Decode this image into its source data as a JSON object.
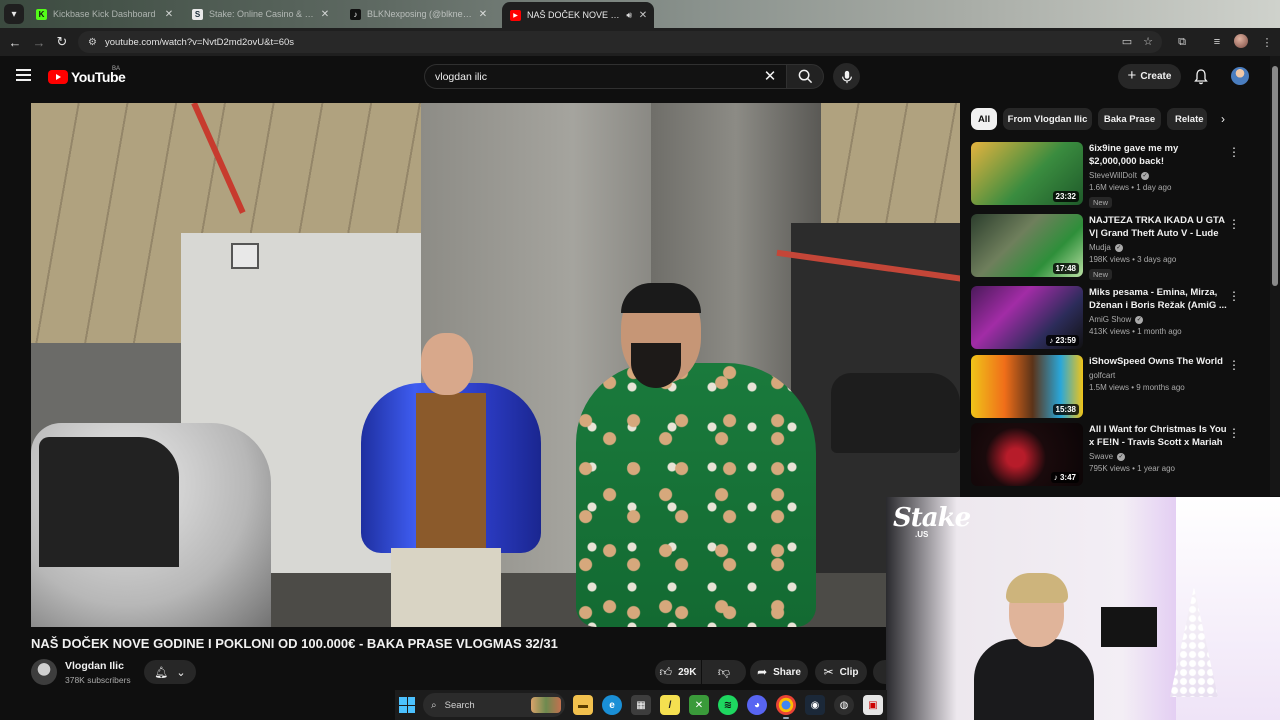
{
  "browser": {
    "tabs": [
      {
        "title": "Kickbase Kick Dashboard",
        "favicon": "kick-favicon"
      },
      {
        "title": "Stake: Online Casino & Sports",
        "favicon": "stake-favicon"
      },
      {
        "title": "BLKNexposing (@blknexposing)",
        "favicon": "tiktok-favicon"
      },
      {
        "title": "NAŠ DOČEK NOVE GODINE I",
        "favicon": "youtube-favicon",
        "active": true
      }
    ],
    "url": "youtube.com/watch?v=NvtD2md2ovU&t=60s"
  },
  "youtube": {
    "logo_text": "YouTube",
    "country_code": "BA",
    "search_query": "vlogdan ilic",
    "create_label": "Create"
  },
  "video": {
    "title": "NAŠ DOČEK NOVE GODINE I POKLONI OD 100.000€ - BAKA PRASE VLOGMAS 32/31",
    "channel": "Vlogdan Ilic",
    "subscribers": "378K subscribers",
    "likes": "29K",
    "share_label": "Share",
    "clip_label": "Clip"
  },
  "sidebar": {
    "chips": [
      "All",
      "From Vlogdan Ilic",
      "Baka Prase",
      "Relate"
    ],
    "recommendations": [
      {
        "title": "6ix9ine gave me my $2,000,000 back!",
        "channel": "SteveWillDoIt",
        "verified": true,
        "meta": "1.6M views • 1 day ago",
        "badge": "New",
        "duration": "23:32"
      },
      {
        "title": "NAJTEZA TRKA IKADA U GTA V| Grand Theft Auto V - Lude ...",
        "channel": "Mudja",
        "verified": true,
        "meta": "198K views • 3 days ago",
        "badge": "New",
        "duration": "17:48"
      },
      {
        "title": "Miks pesama - Emina, Mirza, Dženan i Boris Režak (AmiG ...",
        "channel": "AmiG Show",
        "verified": true,
        "meta": "413K views • 1 month ago",
        "badge": "",
        "duration": "23:59"
      },
      {
        "title": "iShowSpeed Owns The World",
        "channel": "golfcart",
        "verified": false,
        "meta": "1.5M views • 9 months ago",
        "badge": "",
        "duration": "15:38"
      },
      {
        "title": "All I Want for Christmas Is You x FE!N - Travis Scott x Mariah ...",
        "channel": "Swave",
        "verified": true,
        "meta": "795K views • 1 year ago",
        "badge": "",
        "duration": "3:47"
      }
    ]
  },
  "overlay": {
    "brand": "Stake",
    "brand_suffix": ".US"
  },
  "taskbar": {
    "search_label": "Search"
  }
}
